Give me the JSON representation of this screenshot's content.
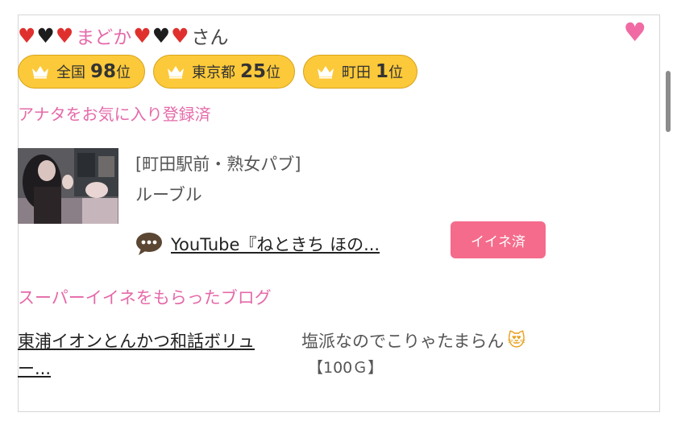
{
  "profile": {
    "hearts_left": [
      "red",
      "black",
      "red"
    ],
    "name": "まどか",
    "hearts_right": [
      "red",
      "black",
      "red"
    ],
    "honorific": "さん",
    "favorite_icon": "heart-icon"
  },
  "ranks": [
    {
      "area": "全国",
      "num": "98",
      "unit": "位"
    },
    {
      "area": "東京都",
      "num": "25",
      "unit": "位"
    },
    {
      "area": "町田",
      "num": "1",
      "unit": "位"
    }
  ],
  "favorite_status": "アナタをお気に入り登録済",
  "shop": {
    "category": "[町田駅前・熟女パブ]",
    "name": "ルーブル"
  },
  "blog": {
    "icon": "speech-bubble-icon",
    "title": "YouTube『ねときち ほの...",
    "like_label": "イイネ済"
  },
  "super_like": {
    "heading": "スーパーイイネをもらったブログ",
    "title_line1": "東浦イオンとんかつ和話ボリュ",
    "title_line2": "ー...",
    "comment": "塩派なのでこりゃたまらん",
    "comment_emoji": "😻",
    "points": "【100Ｇ】"
  },
  "colors": {
    "pink_text": "#e56aa9",
    "rank_badge": "#fcc93a",
    "like_button": "#f56b8b",
    "favorite_heart": "#f06aa3"
  }
}
